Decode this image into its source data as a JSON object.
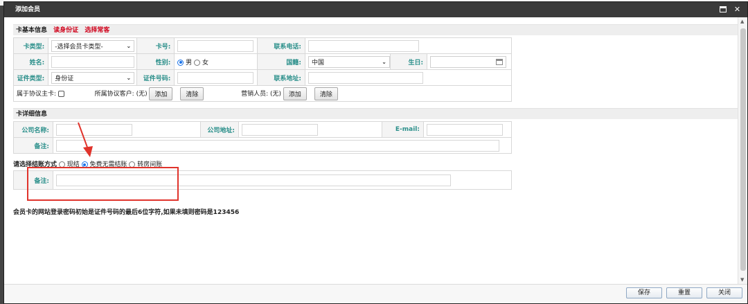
{
  "window": {
    "title": "添加会员"
  },
  "section1": {
    "title": "卡基本信息",
    "link_read_id": "读身份证",
    "link_select_guest": "选择常客"
  },
  "fields": {
    "card_type_label": "卡类型:",
    "card_type_value": "-选择会员卡类型-",
    "card_no_label": "卡号:",
    "phone_label": "联系电话:",
    "name_label": "姓名:",
    "gender_label": "性别:",
    "gender_male": "男",
    "gender_female": "女",
    "country_label": "国籍:",
    "country_value": "中国",
    "birthday_label": "生日:",
    "id_type_label": "证件类型:",
    "id_type_value": "身份证",
    "id_no_label": "证件号码:",
    "address_label": "联系地址:",
    "agreement_label": "属于协议主卡:",
    "agreement_customer_label": "所属协议客户: (无)",
    "sales_label": "营销人员: (无)",
    "add_label": "添加",
    "clear_label": "清除"
  },
  "section2": {
    "title": "卡详细信息"
  },
  "details": {
    "company_label": "公司名称:",
    "company_address_label": "公司地址:",
    "email_label": "E-mail:",
    "remark_label": "备注:"
  },
  "settlement": {
    "prompt": "请选择结账方式",
    "cash": "现结",
    "free": "免费无需结账",
    "transfer": "转房间账",
    "remark_label": "备注:"
  },
  "notice": "会员卡的网站登录密码初始是证件号码的最后6位字符,如果未填则密码是123456",
  "buttons": {
    "save": "保存",
    "reset": "重置",
    "close": "关闭"
  },
  "colors": {
    "label": "#2a8f8a",
    "link": "#d0021b",
    "annotation": "#e0332b",
    "titlebar": "#3a3a3a"
  }
}
